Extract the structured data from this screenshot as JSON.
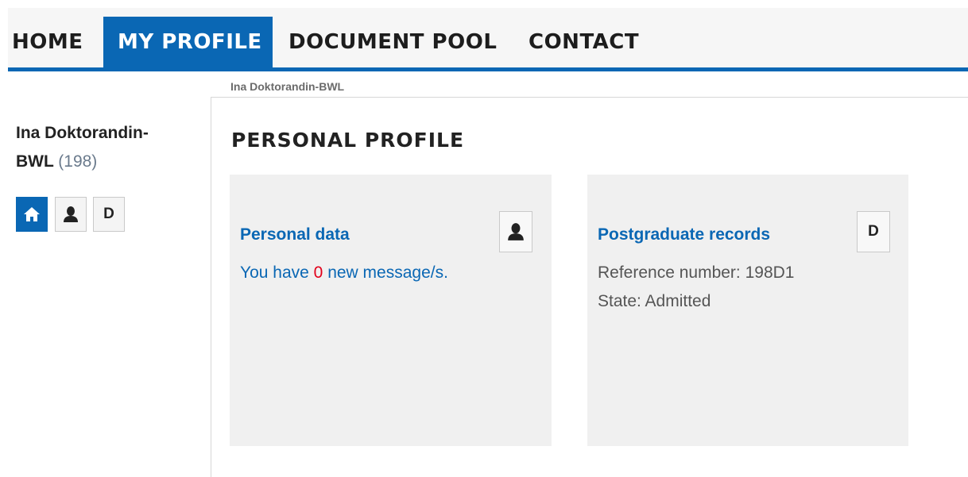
{
  "nav": {
    "items": [
      {
        "label": "HOME",
        "active": false
      },
      {
        "label": "MY PROFILE",
        "active": true
      },
      {
        "label": "DOCUMENT POOL",
        "active": false
      },
      {
        "label": "CONTACT",
        "active": false
      }
    ]
  },
  "breadcrumb": "Ina Doktorandin-BWL",
  "sidebar": {
    "name_line1": "Ina Doktorandin-",
    "name_line2": "BWL",
    "count": "(198)",
    "buttons": [
      {
        "icon": "home-icon",
        "label": ""
      },
      {
        "icon": "user-icon",
        "label": ""
      },
      {
        "icon": "",
        "label": "D"
      }
    ]
  },
  "main": {
    "title": "PERSONAL PROFILE",
    "cards": {
      "personal": {
        "title": "Personal data",
        "message_prefix": "You have",
        "message_count": "0",
        "message_suffix": "new message/s."
      },
      "records": {
        "title": "Postgraduate records",
        "button_label": "D",
        "reference": "Reference number: 198D1",
        "state": "State: Admitted"
      }
    }
  },
  "colors": {
    "accent": "#0a67b4",
    "alert": "#e2001a",
    "card_bg": "#f0f0f0"
  }
}
